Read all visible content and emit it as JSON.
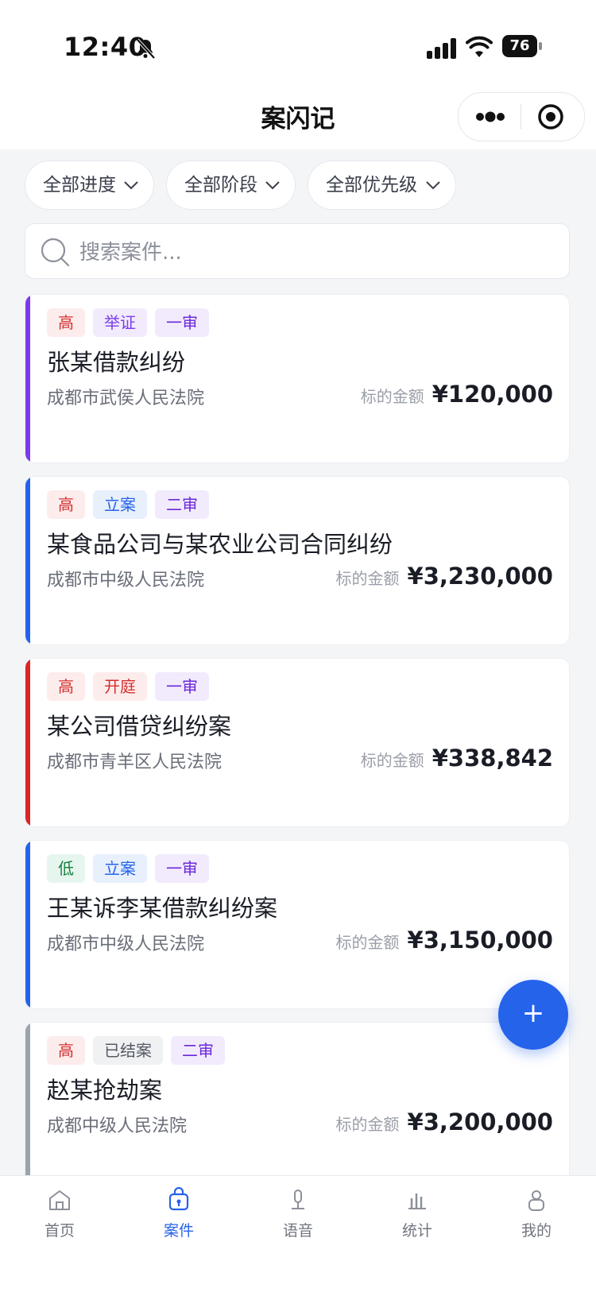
{
  "status_bar": {
    "time": "12:40",
    "battery": "76"
  },
  "header": {
    "title": "案闪记"
  },
  "filters": [
    {
      "label": "全部进度"
    },
    {
      "label": "全部阶段"
    },
    {
      "label": "全部优先级"
    }
  ],
  "search": {
    "placeholder": "搜索案件..."
  },
  "amount_label": "标的金额",
  "cases": [
    {
      "accent": "#7c3aed",
      "tags": [
        "高",
        "举证",
        "一审"
      ],
      "title": "张某借款纠纷",
      "court": "成都市武侯人民法院",
      "amount": "¥120,000"
    },
    {
      "accent": "#2563eb",
      "tags": [
        "高",
        "立案",
        "二审"
      ],
      "title": "某食品公司与某农业公司合同纠纷",
      "court": "成都市中级人民法院",
      "amount": "¥3,230,000"
    },
    {
      "accent": "#dc2626",
      "tags": [
        "高",
        "开庭",
        "一审"
      ],
      "title": "某公司借贷纠纷案",
      "court": "成都市青羊区人民法院",
      "amount": "¥338,842"
    },
    {
      "accent": "#2563eb",
      "tags": [
        "低",
        "立案",
        "一审"
      ],
      "title": "王某诉李某借款纠纷案",
      "court": "成都市中级人民法院",
      "amount": "¥3,150,000"
    },
    {
      "accent": "#9ca3af",
      "tags": [
        "高",
        "已结案",
        "二审"
      ],
      "title": "赵某抢劫案",
      "court": "成都中级人民法院",
      "amount": "¥3,200,000"
    }
  ],
  "fab": {
    "label": "+"
  },
  "tabs": [
    {
      "label": "首页",
      "icon": "home-icon"
    },
    {
      "label": "案件",
      "icon": "briefcase-icon",
      "active": true
    },
    {
      "label": "语音",
      "icon": "microphone-icon"
    },
    {
      "label": "统计",
      "icon": "bar-chart-icon"
    },
    {
      "label": "我的",
      "icon": "user-icon"
    }
  ],
  "colors": {
    "primary": "#2563eb",
    "background": "#f4f5f7"
  }
}
